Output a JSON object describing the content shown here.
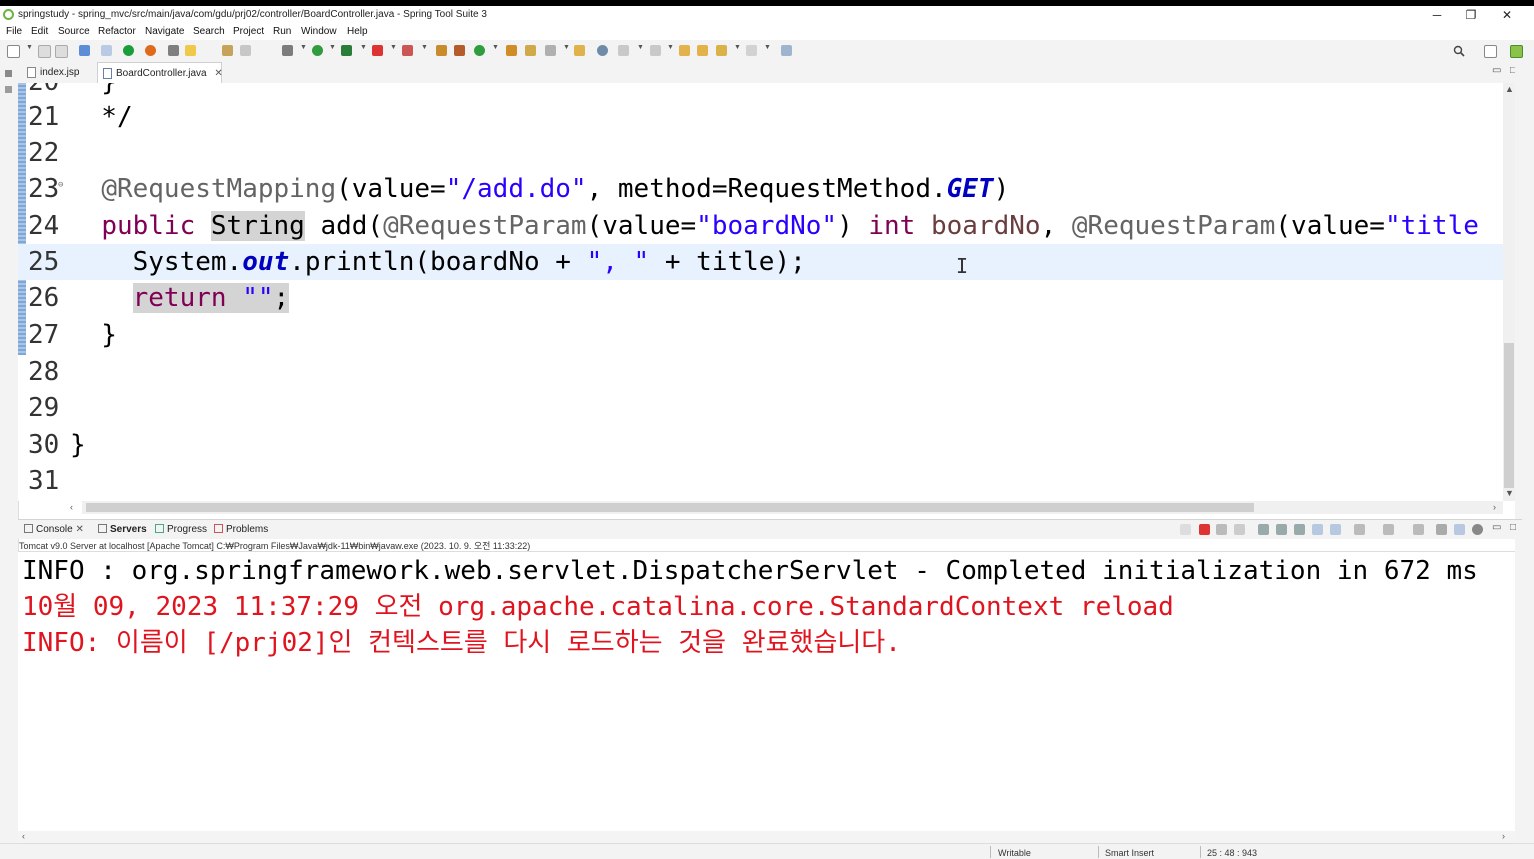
{
  "window": {
    "title": "springstudy - spring_mvc/src/main/java/com/gdu/prj02/controller/BoardController.java - Spring Tool Suite 3",
    "minimize": "─",
    "restore": "❐",
    "close": "✕"
  },
  "menu": [
    "File",
    "Edit",
    "Source",
    "Refactor",
    "Navigate",
    "Search",
    "Project",
    "Run",
    "Window",
    "Help"
  ],
  "editor_tabs": [
    {
      "label": "index.jsp"
    },
    {
      "label": "BoardController.java",
      "close": "✕"
    }
  ],
  "code_lines": [
    {
      "num": "20",
      "code": "  }"
    },
    {
      "num": "21",
      "code": "  */"
    },
    {
      "num": "22",
      "code": ""
    },
    {
      "num": "23",
      "fold": "⊖"
    },
    {
      "num": "24"
    },
    {
      "num": "25"
    },
    {
      "num": "26"
    },
    {
      "num": "27",
      "code": "  }"
    },
    {
      "num": "28",
      "code": ""
    },
    {
      "num": "29",
      "code": ""
    },
    {
      "num": "30",
      "code": "}"
    },
    {
      "num": "31",
      "code": ""
    }
  ],
  "code_tokens": {
    "l23_ann": "@RequestMapping",
    "l23_a": "(value=",
    "l23_str": "\"/add.do\"",
    "l23_b": ", method=RequestMethod.",
    "l23_get": "GET",
    "l23_c": ")",
    "l24_public": "public",
    "l24_string": "String",
    "l24_add": " add(",
    "l24_ann1": "@RequestParam",
    "l24_a": "(value=",
    "l24_str1": "\"boardNo\"",
    "l24_b": ") ",
    "l24_int": "int",
    "l24_param": " boardNo",
    "l24_c": ", ",
    "l24_ann2": "@RequestParam",
    "l24_d": "(value=",
    "l24_str2": "\"title",
    "l25_sys": "System.",
    "l25_out": "out",
    "l25_a": ".println(boardNo + ",
    "l25_str": "\", \"",
    "l25_b": " + title);",
    "l26_return": "return",
    "l26_str": "\"\"",
    "l26_semi": ";"
  },
  "console": {
    "tabs": [
      "Console",
      "Servers",
      "Progress",
      "Problems"
    ],
    "description": "Tomcat v9.0 Server at localhost [Apache Tomcat] C:₩Program Files₩Java₩jdk-11₩bin₩javaw.exe  (2023. 10. 9. 오전 11:33:22)",
    "lines": [
      {
        "text": "INFO : org.springframework.web.servlet.DispatcherServlet - Completed initialization in 672 ms",
        "color": "#000000"
      },
      {
        "text": "10월 09, 2023 11:37:29 오전 org.apache.catalina.core.StandardContext reload",
        "color": "#e0141e"
      },
      {
        "text": "INFO: 이름이 [/prj02]인 컨텍스트를 다시 로드하는 것을 완료했습니다.",
        "color": "#e0141e"
      }
    ]
  },
  "status": {
    "writable": "Writable",
    "insert_mode": "Smart Insert",
    "position": "25 : 48 : 943"
  },
  "colors": {
    "keyword": "#7f0055",
    "string": "#2a00ff",
    "annotation": "#646464",
    "static_field": "#0000c0",
    "current_line": "#e8f2fe",
    "console_error": "#e0141e"
  },
  "icons": [
    "spring-logo-icon",
    "java-file-icon",
    "jsp-file-icon",
    "console-icon",
    "servers-icon",
    "progress-icon",
    "problems-icon",
    "search-icon",
    "perspective-icon"
  ]
}
